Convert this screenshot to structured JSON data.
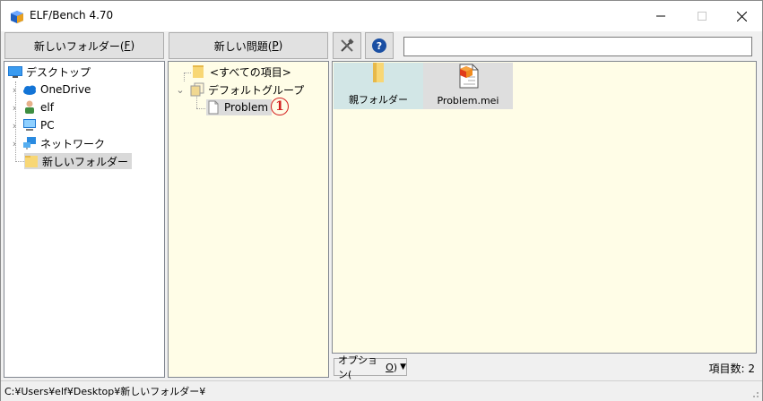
{
  "window": {
    "title": "ELF/Bench 4.70"
  },
  "toolbar": {
    "new_folder_label": "新しいフォルダー(",
    "new_folder_key": "F",
    "new_problem_label": "新しい問題(",
    "new_problem_key": "P",
    "close_paren": ")",
    "search_value": ""
  },
  "folder_tree": {
    "items": [
      {
        "label": "デスクトップ",
        "icon": "desktop-icon"
      },
      {
        "label": "OneDrive",
        "icon": "cloud-icon"
      },
      {
        "label": "elf",
        "icon": "user-icon"
      },
      {
        "label": "PC",
        "icon": "computer-icon"
      },
      {
        "label": "ネットワーク",
        "icon": "network-icon"
      },
      {
        "label": "新しいフォルダー",
        "icon": "folder-icon"
      }
    ]
  },
  "problem_tree": {
    "items": [
      {
        "label": "<すべての項目>",
        "icon": "folder-icon"
      },
      {
        "label": "デフォルトグループ",
        "icon": "group-icon"
      },
      {
        "label": "Problem",
        "icon": "document-icon"
      }
    ],
    "annotation": "1"
  },
  "files": {
    "tiles": [
      {
        "label": "親フォルダー",
        "icon": "folder-icon"
      },
      {
        "label": "Problem.mei",
        "icon": "problem-file-icon"
      }
    ],
    "options_label": "オプション(",
    "options_key": "O",
    "item_count": "項目数: 2"
  },
  "status": {
    "path": "C:¥Users¥elf¥Desktop¥新しいフォルダー¥"
  },
  "colors": {
    "pane_bg": "#fffde7",
    "tile_bg": "#d2e6e6",
    "title_bg": "#ffffff",
    "accent": "#0078d7",
    "annotation": "#d32020"
  }
}
